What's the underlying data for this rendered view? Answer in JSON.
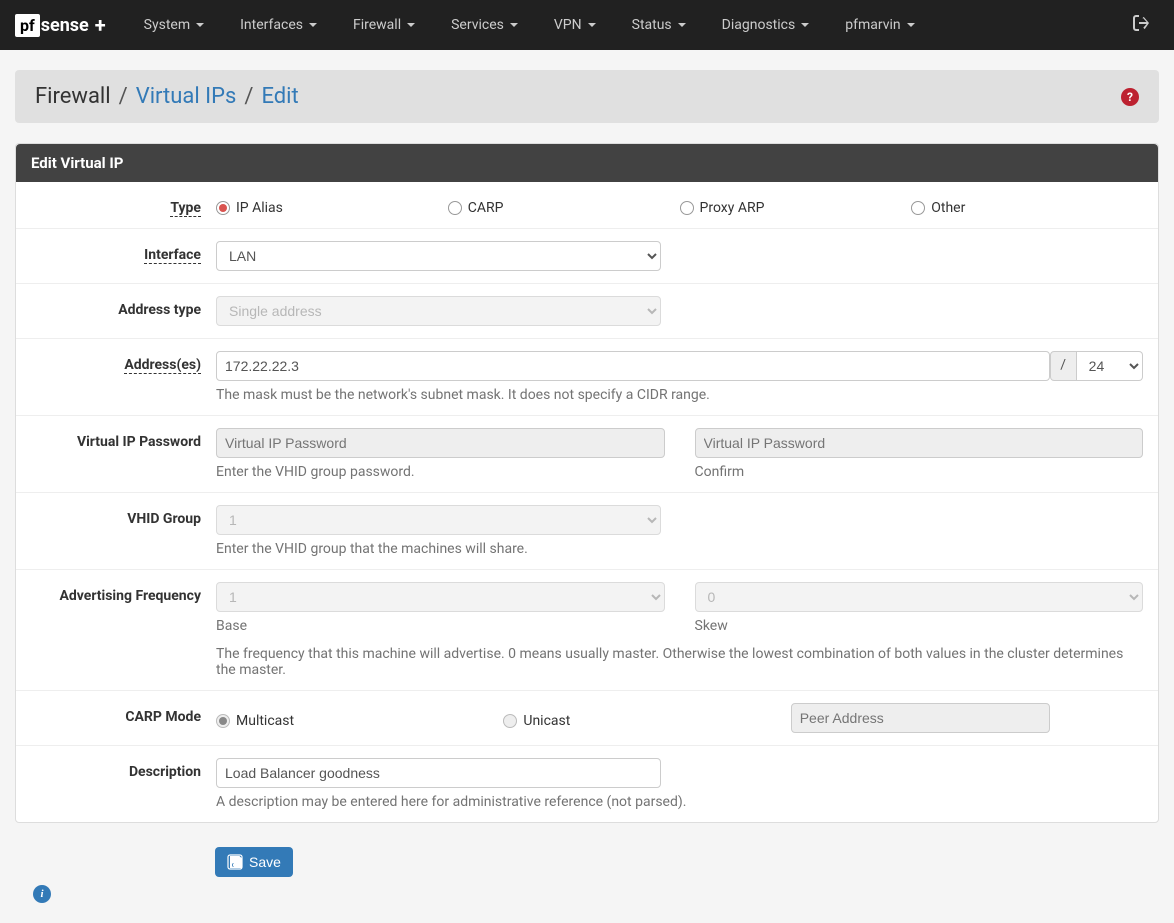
{
  "nav": {
    "menu": [
      "System",
      "Interfaces",
      "Firewall",
      "Services",
      "VPN",
      "Status",
      "Diagnostics",
      "pfmarvin"
    ]
  },
  "breadcrumb": {
    "root": "Firewall",
    "mid": "Virtual IPs",
    "leaf": "Edit"
  },
  "panel": {
    "title": "Edit Virtual IP"
  },
  "labels": {
    "type": "Type",
    "interface": "Interface",
    "addr_type": "Address type",
    "addresses": "Address(es)",
    "vip_password": "Virtual IP Password",
    "vhid_group": "VHID Group",
    "adv_freq": "Advertising Frequency",
    "carp_mode": "CARP Mode",
    "description": "Description"
  },
  "type_options": {
    "ip_alias": "IP Alias",
    "carp": "CARP",
    "proxy_arp": "Proxy ARP",
    "other": "Other"
  },
  "interface": {
    "value": "LAN"
  },
  "addr_type": {
    "value": "Single address"
  },
  "addresses": {
    "value": "172.22.22.3",
    "slash": "/",
    "mask": "24",
    "help": "The mask must be the network's subnet mask. It does not specify a CIDR range."
  },
  "vip_pass": {
    "placeholder": "Virtual IP Password",
    "confirm_placeholder": "Virtual IP Password",
    "help": "Enter the VHID group password.",
    "confirm_help": "Confirm"
  },
  "vhid": {
    "value": "1",
    "help": "Enter the VHID group that the machines will share."
  },
  "adv_freq": {
    "base_value": "1",
    "skew_value": "0",
    "base_label": "Base",
    "skew_label": "Skew",
    "help": "The frequency that this machine will advertise. 0 means usually master. Otherwise the lowest combination of both values in the cluster determines the master."
  },
  "carp_mode": {
    "multicast": "Multicast",
    "unicast": "Unicast",
    "peer_placeholder": "Peer Address"
  },
  "description": {
    "value": "Load Balancer goodness",
    "help": "A description may be entered here for administrative reference (not parsed)."
  },
  "save_button": "Save"
}
